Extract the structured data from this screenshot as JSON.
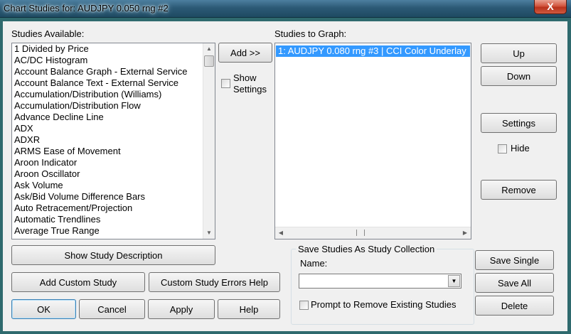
{
  "window": {
    "title": "Chart Studies for: AUDJPY  0.050 rng  #2",
    "close_glyph": "X"
  },
  "available": {
    "label": "Studies Available:",
    "items": [
      "1 Divided by Price",
      "AC/DC Histogram",
      "Account Balance Graph - External Service",
      "Account Balance Text - External Service",
      "Accumulation/Distribution (Williams)",
      "Accumulation/Distribution Flow",
      "Advance Decline Line",
      "ADX",
      "ADXR",
      "ARMS Ease of Movement",
      "Aroon Indicator",
      "Aroon Oscillator",
      "Ask Volume",
      "Ask/Bid Volume Difference Bars",
      "Auto Retracement/Projection",
      "Automatic Trendlines",
      "Average True Range"
    ]
  },
  "middle": {
    "add_label": "Add >>",
    "show_settings_label": "Show",
    "show_settings_label2": "Settings"
  },
  "graph": {
    "label": "Studies to Graph:",
    "items": [
      "1: AUDJPY  0.080 rng  #3 | CCI Color Underlay"
    ]
  },
  "right_buttons": {
    "up": "Up",
    "down": "Down",
    "settings": "Settings",
    "hide": "Hide",
    "remove": "Remove"
  },
  "bottom": {
    "show_description": "Show Study Description",
    "add_custom": "Add Custom Study",
    "custom_errors": "Custom Study Errors Help",
    "ok": "OK",
    "cancel": "Cancel",
    "apply": "Apply",
    "help": "Help"
  },
  "collection": {
    "title": "Save Studies As Study Collection",
    "name_label": "Name:",
    "name_value": "",
    "prompt_label": "Prompt to Remove Existing Studies",
    "save_single": "Save Single",
    "save_all": "Save All",
    "delete": "Delete"
  }
}
